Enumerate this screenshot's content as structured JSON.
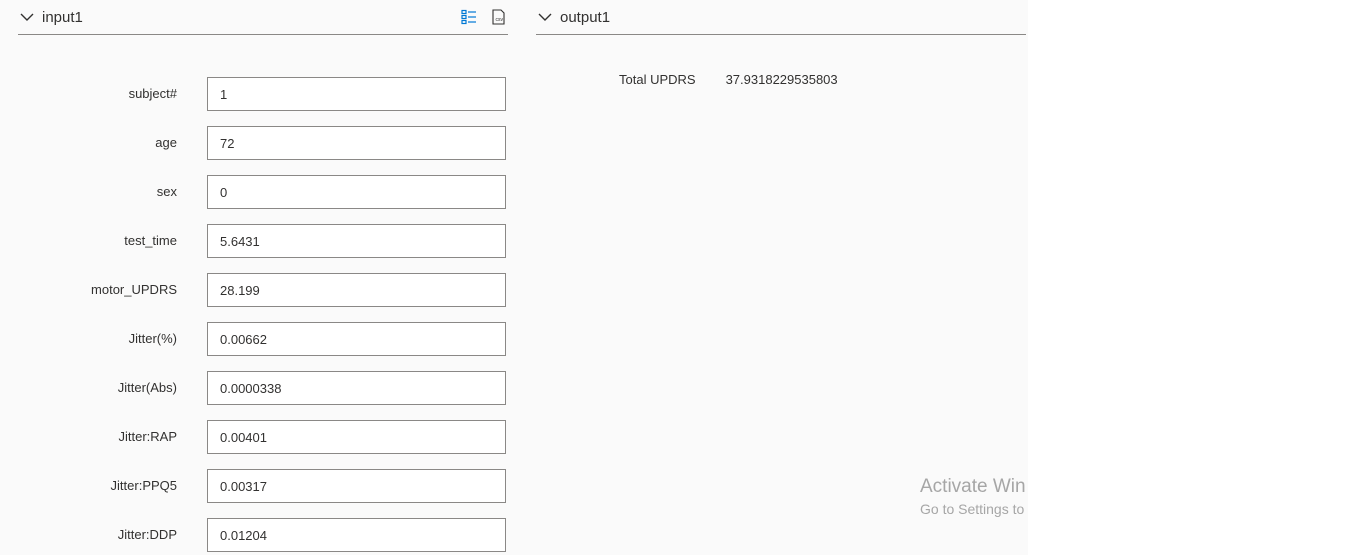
{
  "input_panel": {
    "title": "input1"
  },
  "output_panel": {
    "title": "output1",
    "result_label": "Total UPDRS",
    "result_value": "37.9318229535803"
  },
  "header_icons": [
    "table-view-icon",
    "csv-export-icon"
  ],
  "fields": [
    {
      "label": "subject#",
      "value": "1"
    },
    {
      "label": "age",
      "value": "72"
    },
    {
      "label": "sex",
      "value": "0"
    },
    {
      "label": "test_time",
      "value": "5.6431"
    },
    {
      "label": "motor_UPDRS",
      "value": "28.199"
    },
    {
      "label": "Jitter(%)",
      "value": "0.00662"
    },
    {
      "label": "Jitter(Abs)",
      "value": "0.0000338"
    },
    {
      "label": "Jitter:RAP",
      "value": "0.00401"
    },
    {
      "label": "Jitter:PPQ5",
      "value": "0.00317"
    },
    {
      "label": "Jitter:DDP",
      "value": "0.01204"
    }
  ],
  "watermark": {
    "title": "Activate Win",
    "subtitle": "Go to Settings to"
  },
  "colors": {
    "accent": "#0078d4",
    "border": "#8a8886",
    "text": "#323130",
    "canvas": "#fafafa"
  }
}
